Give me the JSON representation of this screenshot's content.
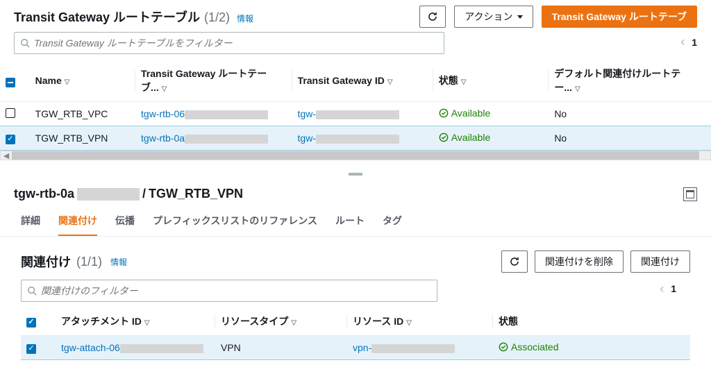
{
  "header": {
    "title": "Transit Gateway ルートテーブル",
    "count": "(1/2)",
    "info": "情報",
    "refresh": "",
    "actions_label": "アクション",
    "primary_action": "Transit Gateway ルートテーブ"
  },
  "filter": {
    "placeholder": "Transit Gateway ルートテーブルをフィルター"
  },
  "pager": {
    "page": "1"
  },
  "columns": {
    "name": "Name",
    "rtb_id": "Transit Gateway ルートテーブ...",
    "tgw_id": "Transit Gateway ID",
    "state": "状態",
    "default_assoc": "デフォルト関連付けルートテー..."
  },
  "rows": [
    {
      "selected": false,
      "name": "TGW_RTB_VPC",
      "rtb_prefix": "tgw-rtb-06",
      "tgw_prefix": "tgw-",
      "state": "Available",
      "default_assoc": "No"
    },
    {
      "selected": true,
      "name": "TGW_RTB_VPN",
      "rtb_prefix": "tgw-rtb-0a",
      "tgw_prefix": "tgw-",
      "state": "Available",
      "default_assoc": "No"
    }
  ],
  "detail": {
    "crumb_prefix": "tgw-rtb-0a",
    "crumb_sep": " / ",
    "crumb_name": "TGW_RTB_VPN",
    "tabs": {
      "details": "詳細",
      "associations": "関連付け",
      "propagations": "伝播",
      "prefix_refs": "プレフィックスリストのリファレンス",
      "routes": "ルート",
      "tags": "タグ"
    },
    "assoc": {
      "title": "関連付け",
      "count": "(1/1)",
      "info": "情報",
      "filter_placeholder": "関連付けのフィルター",
      "delete_btn": "関連付けを削除",
      "create_btn": "関連付け",
      "page": "1",
      "columns": {
        "attachment_id": "アタッチメント ID",
        "resource_type": "リソースタイプ",
        "resource_id": "リソース ID",
        "state": "状態"
      },
      "rows": [
        {
          "selected": true,
          "attach_prefix": "tgw-attach-06",
          "resource_type": "VPN",
          "resource_prefix": "vpn-",
          "state": "Associated"
        }
      ]
    }
  }
}
